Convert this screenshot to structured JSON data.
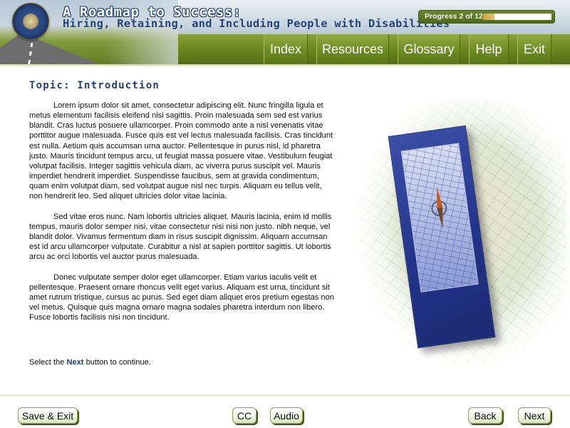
{
  "header": {
    "title": "A Roadmap to Success:",
    "subtitle": "Hiring, Retaining, and Including People with Disabilities"
  },
  "progress": {
    "label": "Progress 2 of 12",
    "current": 2,
    "total": 12,
    "fraction": 0.1667
  },
  "nav": {
    "index": "Index",
    "resources": "Resources",
    "glossary": "Glossary",
    "help": "Help",
    "exit": "Exit"
  },
  "content": {
    "topic": "Topic: Introduction",
    "paragraphs": [
      "Lorem ipsum dolor sit amet, consectetur adipiscing elit. Nunc fringilla ligula et metus elementum facilisis eleifend nisi sagittis. Proin malesuada sem sed est varius blandit. Cras luctus posuere ullamcorper. Proin commodo ante a nisl venenatis vitae porttitor augue malesuada. Fusce quis est vel lectus malesuada facilisis. Cras tincidunt est nulla. Aetium quis accumsan urna auctor. Pellentesque in purus nisl, id pharetra justo. Mauris tincidunt tempus arcu, ut feugiat massa posuere vitae. Vestibulum feugiat volutpat facilisis. Integer sagittis vehicula diam, ac viverra purus suscipit vel. Mauris imperdiet hendrerit imperdiet. Suspendisse faucibus, sem at gravida condimentum, quam enim volutpat diam, sed volutpat augue nisl nec turpis. Aliquam eu tellus velit, non hendrerit leo. Sed aliquet ultricies dolor vitae lacinia.",
      "Sed vitae eros nunc. Nam lobortis ultricies aliquet. Mauris lacinia, enim id mollis tempus, mauris dolor semper nisi, vitae consectetur nisi nisi non justo. nibh neque, vel blandit dolor. Vivamus fermentum diam in risus suscipit dignissim. Aliquam accumsan est id arcu ullamcorper vulputate. Curabitur a nisl at sapien porttitor sagittis. Ut lobortis arcu ac orci lobortis vel auctor purus malesuada.",
      "Donec vulputate semper dolor eget ullamcorper. Etiam varius iaculis velit et pellentesque. Praesent ornare rhoncus velit eget varius. Aliquam est urna, tincidunt sit amet rutrum tristique, cursus ac purus. Sed eget diam aliquet eros pretium egestas non vel metus. Quisque quis magna ornare magna sodales pharetra interdum non libero. Fusce lobortis facilisis nisi non tincidunt."
    ],
    "instruction_prefix": "Select the",
    "instruction_keyword": "Next",
    "instruction_suffix": "button to continue."
  },
  "footer": {
    "save_exit": "Save & Exit",
    "cc": "CC",
    "audio": "Audio",
    "back": "Back",
    "next": "Next"
  },
  "icons": {
    "seal": "agency-seal-icon",
    "road": "road-photo",
    "map": "map-illustration",
    "compass": "compass-icon"
  },
  "colors": {
    "brand_navy": "#1f3f76",
    "nav_green": "#6f8e24",
    "progress_fill": "#d8b45c"
  }
}
